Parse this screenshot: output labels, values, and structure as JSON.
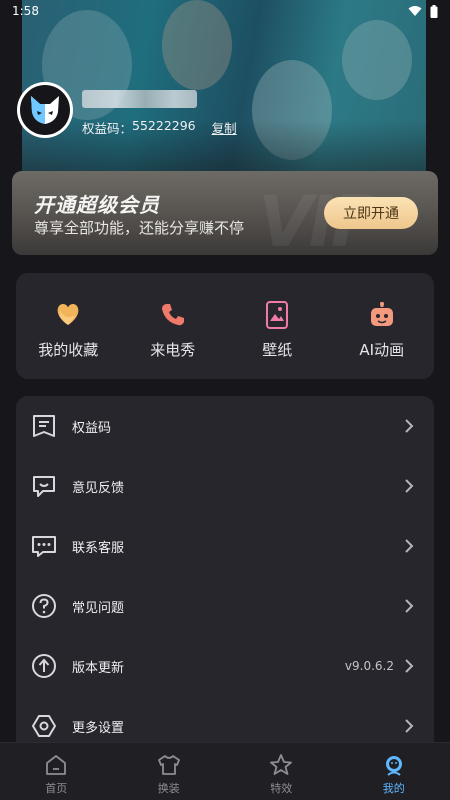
{
  "status_bar": {
    "time": "1:58"
  },
  "profile": {
    "code_label": "权益码：",
    "code_value": "55222296",
    "copy_label": "复制"
  },
  "vip_banner": {
    "title": "开通超级会员",
    "subtitle": "尊享全部功能，还能分享赚不停",
    "button_label": "立即开通"
  },
  "quick_actions": [
    {
      "label": "我的收藏",
      "icon": "heart-icon",
      "color": "#f2b45a"
    },
    {
      "label": "来电秀",
      "icon": "phone-icon",
      "color": "#f07a6a"
    },
    {
      "label": "壁纸",
      "icon": "wallpaper-icon",
      "color": "#f07aa8"
    },
    {
      "label": "AI动画",
      "icon": "robot-icon",
      "color": "#f39a7e"
    }
  ],
  "menu": [
    {
      "label": "权益码",
      "icon": "coupon-icon",
      "value": ""
    },
    {
      "label": "意见反馈",
      "icon": "feedback-icon",
      "value": ""
    },
    {
      "label": "联系客服",
      "icon": "chat-icon",
      "value": ""
    },
    {
      "label": "常见问题",
      "icon": "question-icon",
      "value": ""
    },
    {
      "label": "版本更新",
      "icon": "upgrade-icon",
      "value": "v9.0.6.2"
    },
    {
      "label": "更多设置",
      "icon": "settings-icon",
      "value": ""
    }
  ],
  "tabs": [
    {
      "label": "首页",
      "icon": "home-icon",
      "active": false
    },
    {
      "label": "换装",
      "icon": "shirt-icon",
      "active": false
    },
    {
      "label": "特效",
      "icon": "star-icon",
      "active": false
    },
    {
      "label": "我的",
      "icon": "profile-icon",
      "active": true
    }
  ],
  "colors": {
    "accent": "#5fb7ff",
    "background": "#17171b",
    "card": "#26262c",
    "vip_button": "#eec68b"
  }
}
